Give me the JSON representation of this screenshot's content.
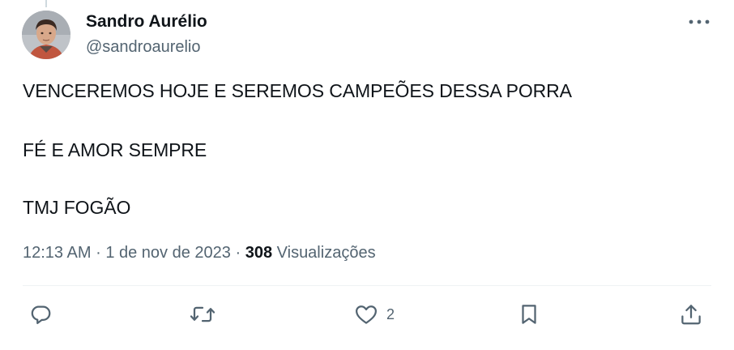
{
  "author": {
    "name": "Sandro Aurélio",
    "handle": "@sandroaurelio"
  },
  "tweet": {
    "lines": [
      "VENCEREMOS HOJE E SEREMOS CAMPEÕES DESSA PORRA",
      "FÉ E AMOR SEMPRE",
      "TMJ FOGÃO"
    ]
  },
  "meta": {
    "time": "12:13 AM",
    "separator": "·",
    "date": "1 de nov de 2023",
    "views_count": "308",
    "views_label": "Visualizações"
  },
  "actions": {
    "reply_icon": "reply-icon",
    "retweet_icon": "retweet-icon",
    "like_icon": "heart-icon",
    "like_count": "2",
    "bookmark_icon": "bookmark-icon",
    "share_icon": "share-icon"
  },
  "colors": {
    "text_primary": "#0f1419",
    "text_secondary": "#536471",
    "divider": "#eff3f4"
  }
}
